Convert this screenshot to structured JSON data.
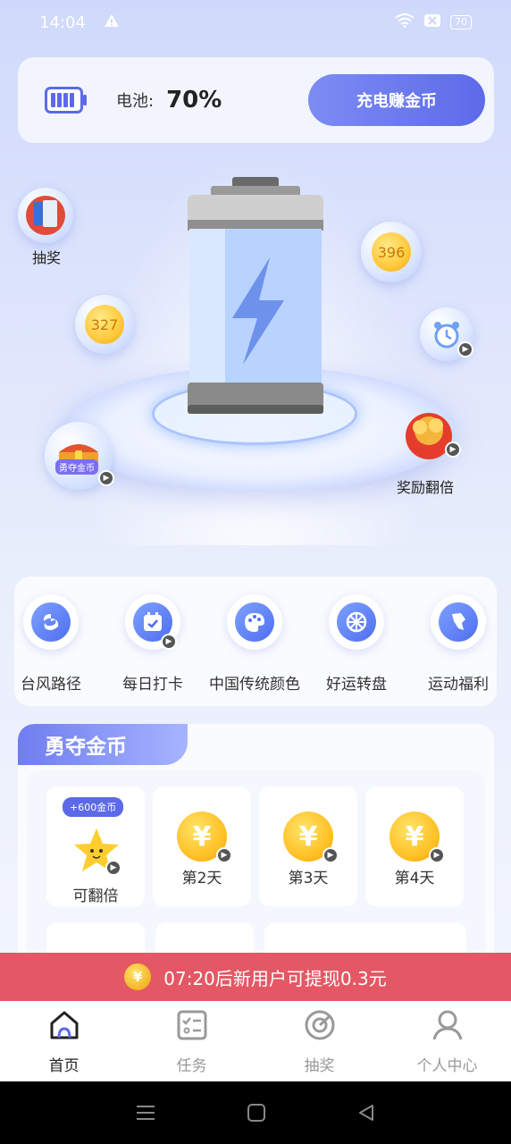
{
  "status_bar": {
    "time": "14:04",
    "battery_level": "70"
  },
  "battery_card": {
    "label": "电池:",
    "value": "70%",
    "charge_button": "充电赚金币"
  },
  "hero": {
    "lottery_label": "抽奖",
    "coin_left": "327",
    "coin_right": "396",
    "chest_label": "勇夺金币",
    "double_reward_label": "奖励翻倍"
  },
  "tools": [
    {
      "label": "台风路径",
      "icon": "typhoon-icon"
    },
    {
      "label": "每日打卡",
      "icon": "calendar-icon"
    },
    {
      "label": "中国传统颜色",
      "icon": "palette-icon"
    },
    {
      "label": "好运转盘",
      "icon": "wheel-icon"
    },
    {
      "label": "运动福利",
      "icon": "sport-icon"
    }
  ],
  "coins_section": {
    "title": "勇夺金币",
    "bonus_pill": "+600金币",
    "day1_label": "可翻倍",
    "days": [
      {
        "label": "第2天",
        "symbol": "¥"
      },
      {
        "label": "第3天",
        "symbol": "¥"
      },
      {
        "label": "第4天",
        "symbol": "¥"
      }
    ]
  },
  "notice": {
    "coin_symbol": "¥",
    "text": "07:20后新用户可提现0.3元"
  },
  "tab_bar": {
    "home": "首页",
    "tasks": "任务",
    "lottery": "抽奖",
    "profile": "个人中心"
  },
  "colors": {
    "accent": "#5c6ae8",
    "notice": "#e35864"
  }
}
